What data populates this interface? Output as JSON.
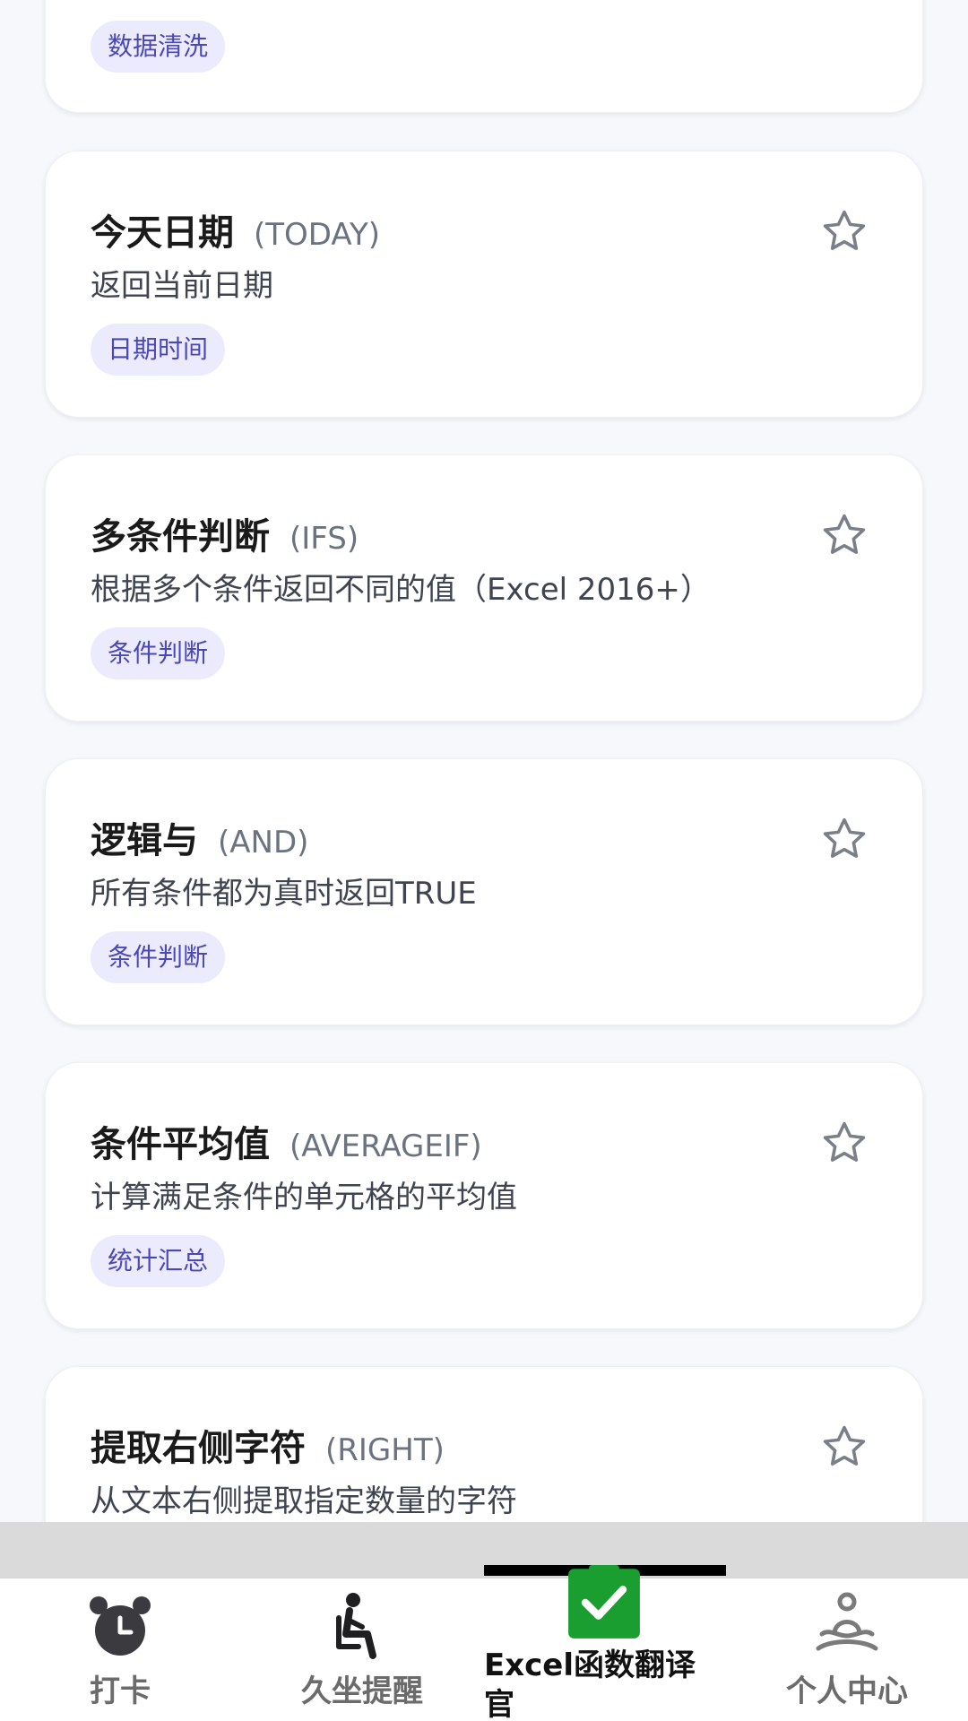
{
  "cards": [
    {
      "title": "",
      "code": "",
      "desc": "",
      "tag": "数据清洗"
    },
    {
      "title": "今天日期",
      "code": "(TODAY)",
      "desc": "返回当前日期",
      "tag": "日期时间"
    },
    {
      "title": "多条件判断",
      "code": "(IFS)",
      "desc": "根据多个条件返回不同的值（Excel 2016+）",
      "tag": "条件判断"
    },
    {
      "title": "逻辑与",
      "code": "(AND)",
      "desc": "所有条件都为真时返回TRUE",
      "tag": "条件判断"
    },
    {
      "title": "条件平均值",
      "code": "(AVERAGEIF)",
      "desc": "计算满足条件的单元格的平均值",
      "tag": "统计汇总"
    },
    {
      "title": "提取右侧字符",
      "code": "(RIGHT)",
      "desc": "从文本右侧提取指定数量的字符",
      "tag": ""
    }
  ],
  "tabbar": {
    "items": [
      {
        "label": "打卡",
        "icon": "alarm-clock-icon"
      },
      {
        "label": "久坐提醒",
        "icon": "seated-person-icon"
      },
      {
        "label": "Excel函数翻译官",
        "icon": "green-check-icon",
        "active": true
      },
      {
        "label": "个人中心",
        "icon": "meditation-person-icon"
      }
    ]
  },
  "colors": {
    "tag_bg": "#ecebfd",
    "tag_text": "#4b47b8",
    "active_icon": "#1a9e2f"
  }
}
